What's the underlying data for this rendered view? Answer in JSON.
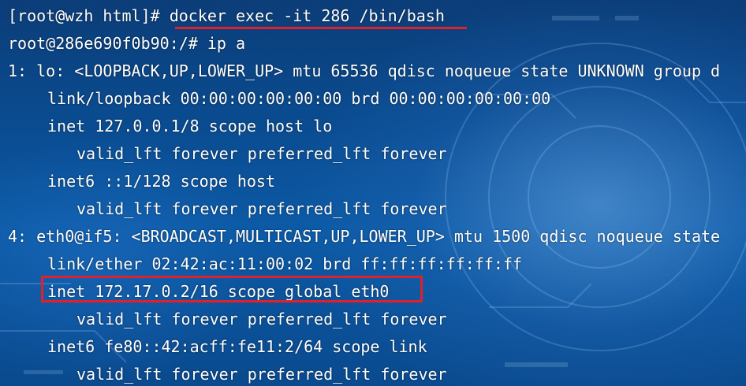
{
  "terminal": {
    "lines": [
      {
        "text": "[root@wzh html]# docker exec -it 286 /bin/bash"
      },
      {
        "text": "root@286e690f0b90:/# ip a"
      },
      {
        "text": "1: lo: <LOOPBACK,UP,LOWER_UP> mtu 65536 qdisc noqueue state UNKNOWN group d"
      },
      {
        "text": "link/loopback 00:00:00:00:00:00 brd 00:00:00:00:00:00"
      },
      {
        "text": "inet 127.0.0.1/8 scope host lo"
      },
      {
        "text": "valid_lft forever preferred_lft forever"
      },
      {
        "text": "inet6 ::1/128 scope host"
      },
      {
        "text": "valid_lft forever preferred_lft forever"
      },
      {
        "text": "4: eth0@if5: <BROADCAST,MULTICAST,UP,LOWER_UP> mtu 1500 qdisc noqueue state"
      },
      {
        "text": "link/ether 02:42:ac:11:00:02 brd ff:ff:ff:ff:ff:ff"
      },
      {
        "text": "inet 172.17.0.2/16 scope global eth0"
      },
      {
        "text": "valid_lft forever preferred_lft forever"
      },
      {
        "text": "inet6 fe80::42:acff:fe11:2/64 scope link"
      },
      {
        "text": "valid_lft forever preferred_lft forever"
      }
    ]
  },
  "colors": {
    "text": "#ffffff",
    "highlight": "#e3202a",
    "background": "#0a4d93"
  }
}
